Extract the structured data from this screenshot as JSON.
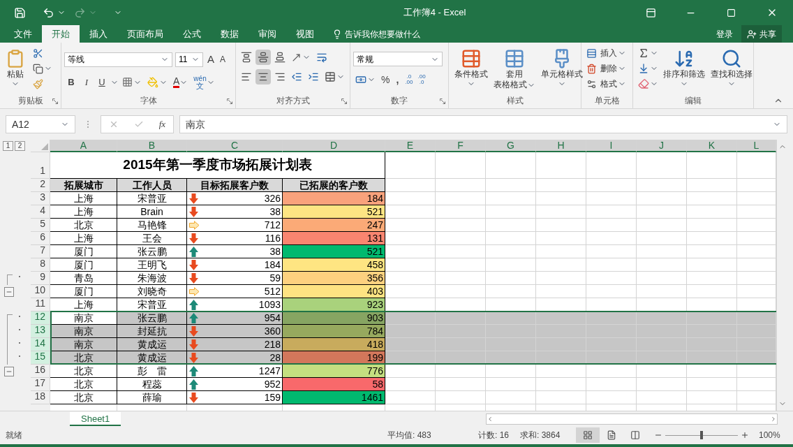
{
  "window": {
    "title": "工作簿4 - Excel"
  },
  "menu_tabs": [
    {
      "label": "文件",
      "selected": false
    },
    {
      "label": "开始",
      "selected": true
    },
    {
      "label": "插入",
      "selected": false
    },
    {
      "label": "页面布局",
      "selected": false
    },
    {
      "label": "公式",
      "selected": false
    },
    {
      "label": "数据",
      "selected": false
    },
    {
      "label": "审阅",
      "selected": false
    },
    {
      "label": "视图",
      "selected": false
    }
  ],
  "tell_me": "告诉我你想要做什么",
  "sign_in": "登录",
  "share": "共享",
  "ribbon": {
    "clipboard": {
      "label": "剪贴板",
      "paste": "粘贴"
    },
    "font": {
      "label": "字体",
      "font_name": "等线",
      "font_size": "11",
      "grow": "A",
      "shrink": "A",
      "bold": "B",
      "italic": "I",
      "underline": "U",
      "font_color": "A",
      "phonetic_top": "wén",
      "phonetic_bottom": "文"
    },
    "alignment": {
      "label": "对齐方式",
      "vertical": [
        {
          "selected": false
        },
        {
          "selected": true
        },
        {
          "selected": false
        }
      ],
      "horizontal": [
        {
          "selected": false
        },
        {
          "selected": true
        },
        {
          "selected": false
        }
      ]
    },
    "number": {
      "label": "数字",
      "format": "常规",
      "percent": "%",
      "comma": ",",
      "increase_decimal": [
        ".0",
        ".00"
      ],
      "decrease_decimal": [
        ".00",
        ".0"
      ]
    },
    "styles": {
      "label": "样式",
      "conditional": "条件格式",
      "table_top": "套用",
      "table_bottom": "表格格式",
      "cell_styles": "单元格样式"
    },
    "cells": {
      "label": "单元格",
      "insert": "插入",
      "delete": "删除",
      "format": "格式"
    },
    "editing": {
      "label": "编辑",
      "sort": "排序和筛选",
      "find": "查找和选择"
    }
  },
  "formula_bar": {
    "name_box": "A12",
    "fx": "fx",
    "value": "南京"
  },
  "outline_levels": [
    "1",
    "2"
  ],
  "columns": [
    {
      "label": "A",
      "highlighted": true
    },
    {
      "label": "B",
      "highlighted": true
    },
    {
      "label": "C",
      "highlighted": true
    },
    {
      "label": "D",
      "highlighted": true
    },
    {
      "label": "E",
      "highlighted": true
    },
    {
      "label": "F",
      "highlighted": true
    },
    {
      "label": "G",
      "highlighted": true
    },
    {
      "label": "H",
      "highlighted": true
    },
    {
      "label": "I",
      "highlighted": true
    },
    {
      "label": "J",
      "highlighted": true
    },
    {
      "label": "K",
      "highlighted": true
    },
    {
      "label": "L",
      "highlighted": true
    }
  ],
  "title_row": {
    "number": "1",
    "text": "2015年第一季度市场拓展计划表"
  },
  "header_row": {
    "number": "2",
    "cells": [
      "拓展城市",
      "工作人员",
      "目标拓展客户数",
      "已拓展的客户数"
    ]
  },
  "rows": [
    {
      "number": "3",
      "city": "上海",
      "person": "宋普亚",
      "trend": {
        "kind": "down"
      },
      "target": "326",
      "done": "184",
      "color": "#f9a27c",
      "selected": false
    },
    {
      "number": "4",
      "city": "上海",
      "person": "Brain",
      "trend": {
        "kind": "down"
      },
      "target": "38",
      "done": "521",
      "color": "#fde583",
      "selected": false
    },
    {
      "number": "5",
      "city": "北京",
      "person": "马艳锋",
      "trend": {
        "kind": "right"
      },
      "target": "712",
      "done": "247",
      "color": "#fbaa77",
      "selected": false
    },
    {
      "number": "6",
      "city": "上海",
      "person": "王会",
      "trend": {
        "kind": "down"
      },
      "target": "116",
      "done": "131",
      "color": "#f98570",
      "selected": false
    },
    {
      "number": "7",
      "city": "厦门",
      "person": "张云鹏",
      "trend": {
        "kind": "up"
      },
      "target": "38",
      "done": "521",
      "color": "#00b96f",
      "selected": false
    },
    {
      "number": "8",
      "city": "厦门",
      "person": "王明飞",
      "trend": {
        "kind": "down"
      },
      "target": "184",
      "done": "458",
      "color": "#fee582",
      "selected": false
    },
    {
      "number": "9",
      "city": "青岛",
      "person": "朱海波",
      "trend": {
        "kind": "down"
      },
      "target": "59",
      "done": "356",
      "color": "#fdd17f",
      "selected": false,
      "outline": {
        "kind": "start"
      }
    },
    {
      "number": "10",
      "city": "厦门",
      "person": "刘晓奇",
      "trend": {
        "kind": "right"
      },
      "target": "512",
      "done": "403",
      "color": "#fee382",
      "selected": false,
      "outline": {
        "kind": "collapse"
      }
    },
    {
      "number": "11",
      "city": "上海",
      "person": "宋普亚",
      "trend": {
        "kind": "up"
      },
      "target": "1093",
      "done": "923",
      "color": "#a9d27c",
      "selected": false
    },
    {
      "number": "12",
      "city": "南京",
      "person": "张云鹏",
      "trend": {
        "kind": "up"
      },
      "target": "954",
      "done": "903",
      "color": "#87a562",
      "selected": true,
      "active": true,
      "outline": {
        "kind": "start"
      }
    },
    {
      "number": "13",
      "city": "南京",
      "person": "封延抗",
      "trend": {
        "kind": "down"
      },
      "target": "360",
      "done": "784",
      "color": "#97a95e",
      "selected": true,
      "active": false,
      "outline": {
        "kind": "dot"
      }
    },
    {
      "number": "14",
      "city": "南京",
      "person": "黄成运",
      "trend": {
        "kind": "down"
      },
      "target": "218",
      "done": "418",
      "color": "#c8ab5d",
      "selected": true,
      "active": false,
      "outline": {
        "kind": "dot"
      }
    },
    {
      "number": "15",
      "city": "北京",
      "person": "黄成运",
      "trend": {
        "kind": "down"
      },
      "target": "28",
      "done": "199",
      "color": "#d3775b",
      "selected": true,
      "active": false,
      "outline": {
        "kind": "dot"
      }
    },
    {
      "number": "16",
      "city": "北京",
      "person": "彭　雷",
      "trend": {
        "kind": "up"
      },
      "target": "1247",
      "done": "776",
      "color": "#c4df80",
      "selected": false,
      "outline": {
        "kind": "collapse"
      }
    },
    {
      "number": "17",
      "city": "北京",
      "person": "程蕊",
      "trend": {
        "kind": "up"
      },
      "target": "952",
      "done": "58",
      "color": "#f8696b",
      "selected": false
    },
    {
      "number": "18",
      "city": "北京",
      "person": "薛瑜",
      "trend": {
        "kind": "down"
      },
      "target": "159",
      "done": "1461",
      "color": "#00b96f",
      "selected": false
    }
  ],
  "sheet_tabs": [
    {
      "label": "Sheet1",
      "selected": true
    }
  ],
  "status_bar": {
    "ready": "就绪",
    "average": "平均值: 483",
    "count": "计数: 16",
    "sum": "求和: 3864",
    "views": [
      {
        "selected": true
      },
      {
        "selected": false
      },
      {
        "selected": false
      }
    ],
    "zoom": {
      "level": 0.5
    },
    "zoom_text": "100%"
  }
}
